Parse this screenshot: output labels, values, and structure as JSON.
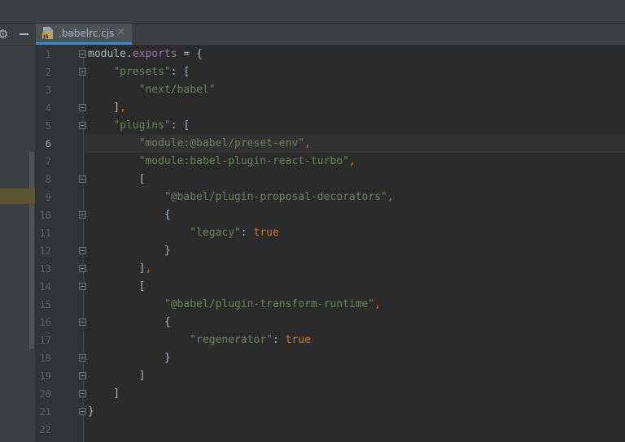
{
  "tab": {
    "filename": ".babelrc.cjs",
    "close": "×",
    "icon": "js-file-icon"
  },
  "toolbar": {
    "settings_icon": "⚙"
  },
  "current_line": 6,
  "lines": [
    {
      "n": "1",
      "tokens": [
        {
          "t": "module.",
          "c": ""
        },
        {
          "t": "exports",
          "c": "p"
        },
        {
          "t": " = {",
          "c": ""
        }
      ]
    },
    {
      "n": "2",
      "tokens": [
        {
          "t": "    ",
          "c": ""
        },
        {
          "t": "\"presets\"",
          "c": "s"
        },
        {
          "t": ": [",
          "c": ""
        }
      ]
    },
    {
      "n": "3",
      "tokens": [
        {
          "t": "        ",
          "c": ""
        },
        {
          "t": "\"next/babel\"",
          "c": "s"
        }
      ]
    },
    {
      "n": "4",
      "tokens": [
        {
          "t": "    ]",
          "c": ""
        },
        {
          "t": ",",
          "c": "k"
        }
      ]
    },
    {
      "n": "5",
      "tokens": [
        {
          "t": "    ",
          "c": ""
        },
        {
          "t": "\"plugins\"",
          "c": "s"
        },
        {
          "t": ": [",
          "c": ""
        }
      ]
    },
    {
      "n": "6",
      "tokens": [
        {
          "t": "        ",
          "c": ""
        },
        {
          "t": "\"module:@babel/preset-env\"",
          "c": "s"
        },
        {
          "t": ",",
          "c": "k"
        }
      ]
    },
    {
      "n": "7",
      "tokens": [
        {
          "t": "        ",
          "c": ""
        },
        {
          "t": "\"module:babel-plugin-react-turbo\"",
          "c": "s"
        },
        {
          "t": ",",
          "c": "k"
        }
      ]
    },
    {
      "n": "8",
      "tokens": [
        {
          "t": "        [",
          "c": ""
        }
      ]
    },
    {
      "n": "9",
      "tokens": [
        {
          "t": "            ",
          "c": ""
        },
        {
          "t": "\"@babel/plugin-proposal-decorators\"",
          "c": "s"
        },
        {
          "t": ",",
          "c": "k"
        }
      ]
    },
    {
      "n": "10",
      "tokens": [
        {
          "t": "            {",
          "c": ""
        }
      ]
    },
    {
      "n": "11",
      "tokens": [
        {
          "t": "                ",
          "c": ""
        },
        {
          "t": "\"legacy\"",
          "c": "s"
        },
        {
          "t": ": ",
          "c": ""
        },
        {
          "t": "true",
          "c": "k"
        }
      ]
    },
    {
      "n": "12",
      "tokens": [
        {
          "t": "            }",
          "c": ""
        }
      ]
    },
    {
      "n": "13",
      "tokens": [
        {
          "t": "        ]",
          "c": ""
        },
        {
          "t": ",",
          "c": "k"
        }
      ]
    },
    {
      "n": "14",
      "tokens": [
        {
          "t": "        [",
          "c": ""
        }
      ]
    },
    {
      "n": "15",
      "tokens": [
        {
          "t": "            ",
          "c": ""
        },
        {
          "t": "\"@babel/plugin-transform-runtime\"",
          "c": "s"
        },
        {
          "t": ",",
          "c": "k"
        }
      ]
    },
    {
      "n": "16",
      "tokens": [
        {
          "t": "            {",
          "c": ""
        }
      ]
    },
    {
      "n": "17",
      "tokens": [
        {
          "t": "                ",
          "c": ""
        },
        {
          "t": "\"regenerator\"",
          "c": "s"
        },
        {
          "t": ": ",
          "c": ""
        },
        {
          "t": "true",
          "c": "k"
        }
      ]
    },
    {
      "n": "18",
      "tokens": [
        {
          "t": "            }",
          "c": ""
        }
      ]
    },
    {
      "n": "19",
      "tokens": [
        {
          "t": "        ]",
          "c": ""
        }
      ]
    },
    {
      "n": "20",
      "tokens": [
        {
          "t": "    ]",
          "c": ""
        }
      ]
    },
    {
      "n": "21",
      "tokens": [
        {
          "t": "}",
          "c": ""
        }
      ]
    },
    {
      "n": "22",
      "tokens": []
    }
  ],
  "fold_markers": [
    1,
    2,
    4,
    5,
    8,
    10,
    12,
    13,
    14,
    16,
    18,
    19,
    20,
    21
  ],
  "colors": {
    "background": "#2b2b2b",
    "string": "#6a8759",
    "keyword": "#cc7832",
    "property": "#9876aa",
    "text": "#a9b7c6",
    "tab_underline": "#4a88c7"
  }
}
